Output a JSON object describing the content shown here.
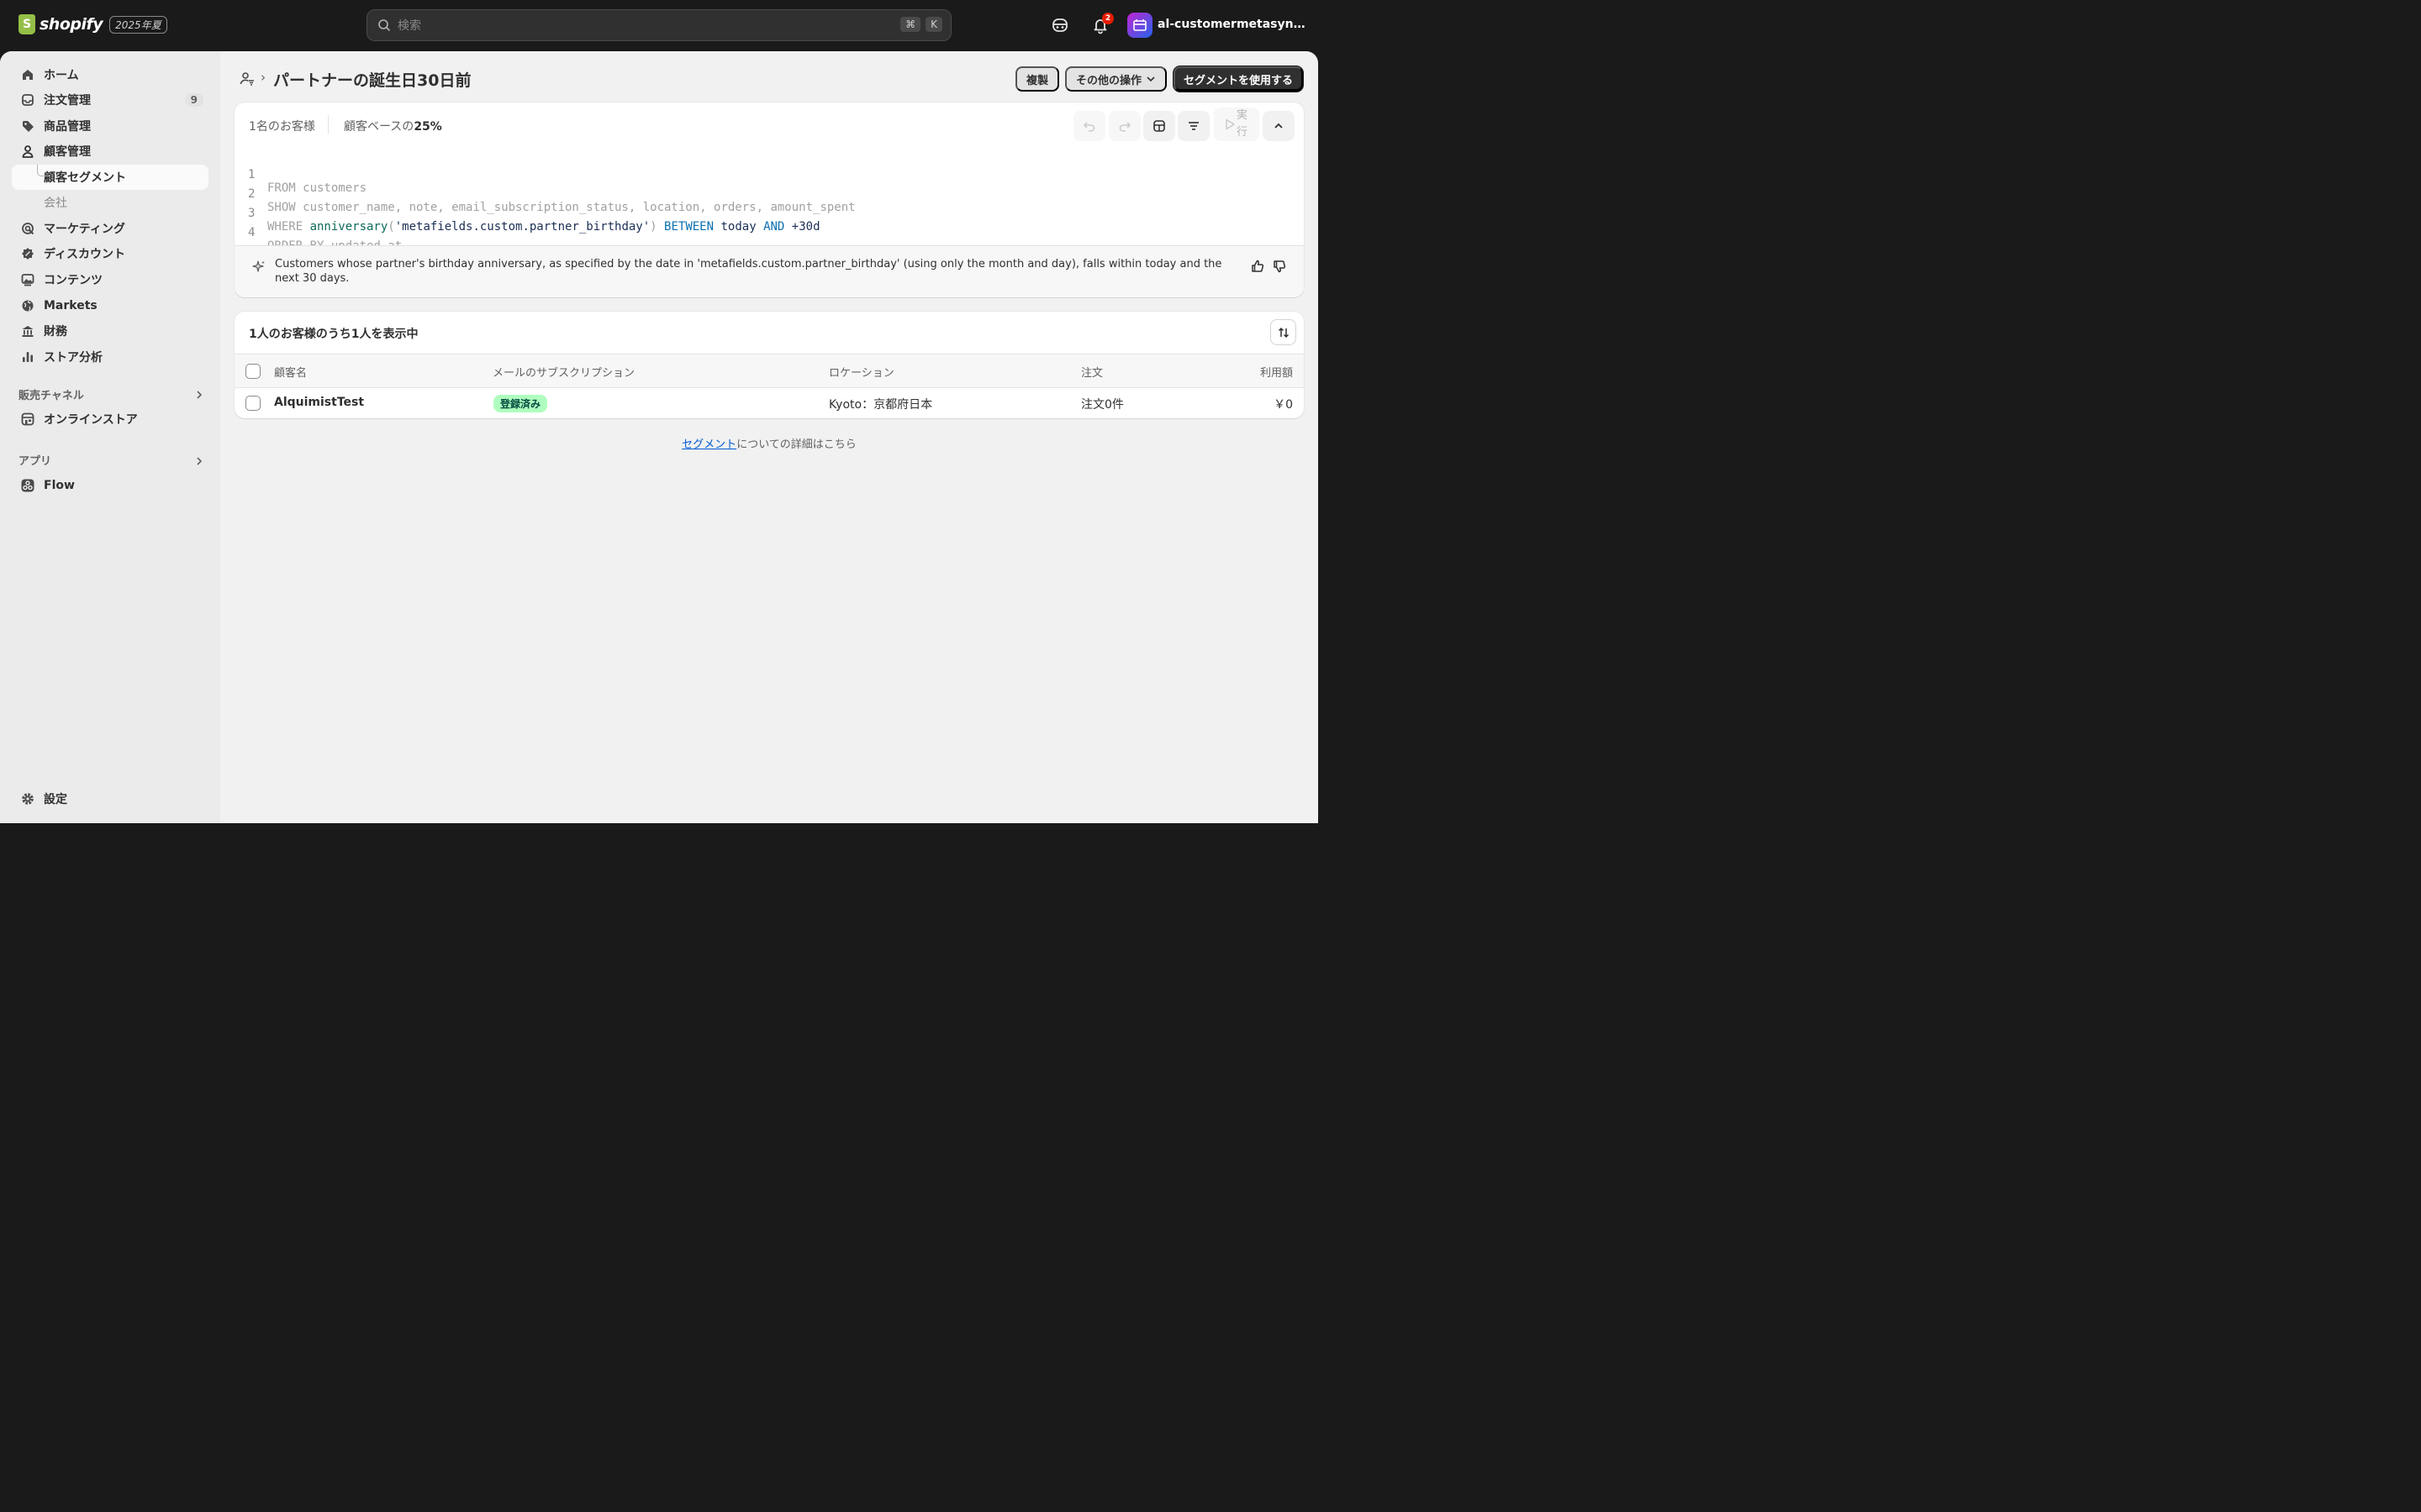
{
  "topbar": {
    "brand": "shopify",
    "edition_badge": "2025年夏",
    "search_placeholder": "検索",
    "search_shortcut": [
      "⌘",
      "K"
    ],
    "notification_count": "2",
    "store_name": "al-customermetasync-de..."
  },
  "sidebar": {
    "items": [
      {
        "label": "ホーム",
        "icon": "home-icon"
      },
      {
        "label": "注文管理",
        "icon": "inbox-icon",
        "count": "9"
      },
      {
        "label": "商品管理",
        "icon": "tag-icon"
      },
      {
        "label": "顧客管理",
        "icon": "person-icon"
      },
      {
        "label": "顧客セグメント",
        "sub": true,
        "active": true
      },
      {
        "label": "会社",
        "sub": true
      },
      {
        "label": "マーケティング",
        "icon": "target-icon"
      },
      {
        "label": "ディスカウント",
        "icon": "discount-icon"
      },
      {
        "label": "コンテンツ",
        "icon": "image-icon"
      },
      {
        "label": "Markets",
        "icon": "globe-icon"
      },
      {
        "label": "財務",
        "icon": "bank-icon"
      },
      {
        "label": "ストア分析",
        "icon": "bar-chart-icon"
      }
    ],
    "sales_channels_heading": "販売チャネル",
    "online_store": "オンラインストア",
    "apps_heading": "アプリ",
    "flow": "Flow",
    "settings": "設定"
  },
  "page": {
    "title": "パートナーの誕生日30日前",
    "actions": {
      "duplicate": "複製",
      "more_actions": "その他の操作",
      "use_segment": "セグメントを使用する"
    }
  },
  "editor": {
    "customer_count": "1名のお客様",
    "base_share_label": "顧客ベースの",
    "base_share_value": "25%",
    "run_label": "実行",
    "code_lines": [
      {
        "num": "1",
        "text": "FROM customers"
      },
      {
        "num": "2",
        "text": "SHOW customer_name, note, email_subscription_status, location, orders, amount_spent"
      },
      {
        "num": "3",
        "where": "WHERE ",
        "fn": "anniversary",
        "open": "(",
        "arg": "'metafields.custom.partner_birthday'",
        "close": ") ",
        "between": "BETWEEN",
        "today": " today ",
        "and": "AND",
        "plus": " +30d"
      },
      {
        "num": "4",
        "text": "ORDER BY updated_at"
      }
    ],
    "ai_summary": "Customers whose partner's birthday anniversary, as specified by the date in 'metafields.custom.partner_birthday' (using only the month and day), falls within today and the next 30 days."
  },
  "results": {
    "title": "1人のお客様のうち1人を表示中",
    "columns": [
      "顧客名",
      "メールのサブスクリプション",
      "ロケーション",
      "注文",
      "利用額"
    ],
    "rows": [
      {
        "name": "AlquimistTest",
        "subscription": "登録済み",
        "location": "Kyoto：京都府日本",
        "orders": "注文0件",
        "spent": "￥0"
      }
    ]
  },
  "footer": {
    "link": "セグメント",
    "text": "についての詳細はこちら"
  },
  "colors": {
    "topbar": "#1a1a1a",
    "canvas": "#f1f1f1",
    "sidebar": "#ebebeb",
    "primary_button": "#303030",
    "success_badge": "#affebf",
    "link": "#005bd3"
  }
}
